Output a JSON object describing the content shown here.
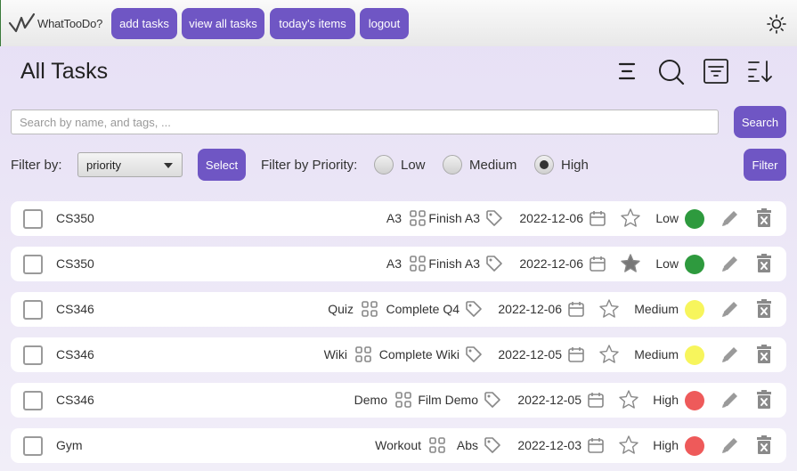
{
  "app": {
    "logo_text": "WhatTooDo?"
  },
  "nav": [
    {
      "label": "add tasks"
    },
    {
      "label": "view all tasks"
    },
    {
      "label": "today's items"
    },
    {
      "label": "logout"
    }
  ],
  "theme_toggle_icon": "sun-icon",
  "page": {
    "title": "All Tasks"
  },
  "header_icons": [
    "menu-icon",
    "search-icon",
    "filter-icon",
    "sort-icon"
  ],
  "search": {
    "placeholder": "Search by name, and tags, ...",
    "value": "",
    "button_label": "Search"
  },
  "filter": {
    "label": "Filter by:",
    "selected": "priority",
    "select_button": "Select",
    "priority_label": "Filter by Priority:",
    "options": [
      "Low",
      "Medium",
      "High"
    ],
    "checked": "High",
    "filter_button": "Filter"
  },
  "colors": {
    "accent": "#6f56c4",
    "low": "#2e9a3e",
    "medium": "#f7f55c",
    "high": "#ee5a5a"
  },
  "tasks": [
    {
      "course": "CS350",
      "name": "A3",
      "tag": "Finish A3",
      "date": "2022-12-06",
      "starred": false,
      "priority": "Low",
      "completed": false
    },
    {
      "course": "CS350",
      "name": "A3",
      "tag": "Finish A3",
      "date": "2022-12-06",
      "starred": true,
      "priority": "Low",
      "completed": false
    },
    {
      "course": "CS346",
      "name": "Quiz",
      "tag": "Complete Q4",
      "date": "2022-12-06",
      "starred": false,
      "priority": "Medium",
      "completed": false
    },
    {
      "course": "CS346",
      "name": "Wiki",
      "tag": "Complete Wiki",
      "date": "2022-12-05",
      "starred": false,
      "priority": "Medium",
      "completed": false
    },
    {
      "course": "CS346",
      "name": "Demo",
      "tag": "Film Demo",
      "date": "2022-12-05",
      "starred": false,
      "priority": "High",
      "completed": false
    },
    {
      "course": "Gym",
      "name": "Workout",
      "tag": "Abs",
      "date": "2022-12-03",
      "starred": false,
      "priority": "High",
      "completed": false
    }
  ]
}
